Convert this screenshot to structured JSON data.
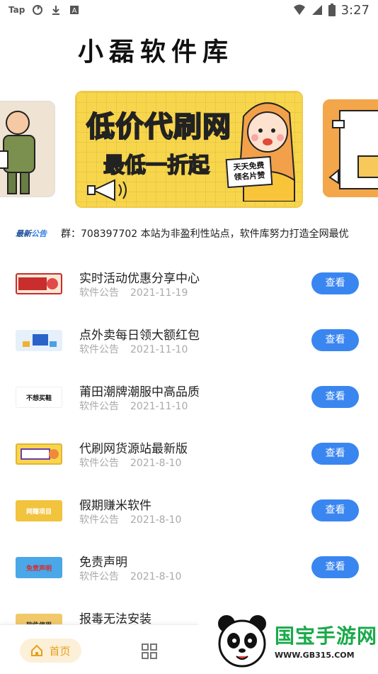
{
  "status_bar": {
    "time": "3:27",
    "left_icons": [
      "tap-icon",
      "settings-sync-icon",
      "download-icon",
      "text-a-icon"
    ],
    "right_icons": [
      "wifi-icon",
      "signal-icon",
      "battery-icon"
    ]
  },
  "app": {
    "title": "小磊软件库"
  },
  "banner": {
    "main_title": "低价代刷网",
    "main_subtitle": "最低一折起",
    "main_note": "天天免费领名片赞"
  },
  "notice": {
    "badge_word1": "最新",
    "badge_word2": "公告",
    "text": "群：708397702 本站为非盈利性站点，软件库努力打造全网最优"
  },
  "articles": [
    {
      "title": "实时活动优惠分享中心",
      "category": "软件公告",
      "date": "2021-11-19",
      "button": "查看",
      "thumb_color": "#c92d2d",
      "thumb_bg": "#f7e9d6"
    },
    {
      "title": "点外卖每日领大额红包",
      "category": "软件公告",
      "date": "2021-11-10",
      "button": "查看",
      "thumb_color": "#2a62c9",
      "thumb_bg": "#e5f0fb"
    },
    {
      "title": "莆田潮牌潮服中高品质",
      "category": "软件公告",
      "date": "2021-11-10",
      "button": "查看",
      "thumb_color": "#111111",
      "thumb_bg": "#ffffff",
      "thumb_text": "不想买鞋"
    },
    {
      "title": "代刷网货源站最新版",
      "category": "软件公告",
      "date": "2021-8-10",
      "button": "查看",
      "thumb_color": "#6b3fb0",
      "thumb_bg": "#f8d64c"
    },
    {
      "title": "假期赚米软件",
      "category": "软件公告",
      "date": "2021-8-10",
      "button": "查看",
      "thumb_color": "#ffffff",
      "thumb_bg": "#f2c33c",
      "thumb_text": "网赚项目"
    },
    {
      "title": "免责声明",
      "category": "软件公告",
      "date": "2021-8-10",
      "button": "查看",
      "thumb_color": "#d62b2b",
      "thumb_bg": "#4aa7e8",
      "thumb_text": "免责声明"
    },
    {
      "title": "报毒无法安装",
      "category": "",
      "date": "",
      "button": "",
      "thumb_color": "#333333",
      "thumb_bg": "#f1c96a",
      "thumb_text": "软件使用"
    }
  ],
  "tabbar": {
    "home_label": "首页"
  },
  "watermark": {
    "title": "国宝手游网",
    "url": "WWW.GB315.COM"
  }
}
